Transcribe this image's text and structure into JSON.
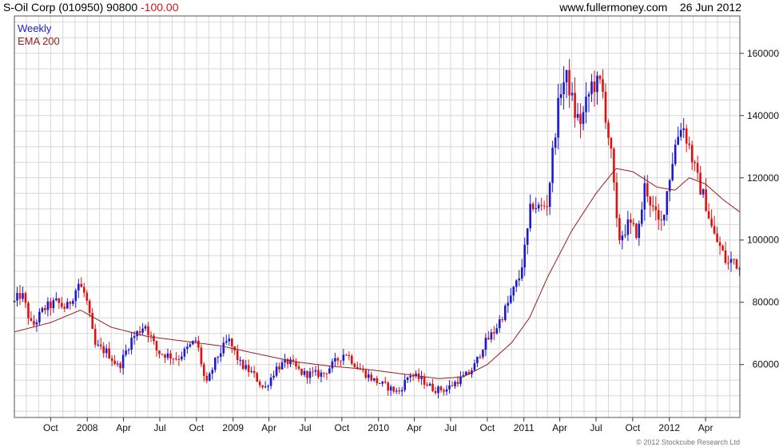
{
  "header": {
    "name": "S-Oil Corp (010950)",
    "price": "90800",
    "change": "-100.00",
    "site": "www.fullermoney.com",
    "date": "26 Jun 2012"
  },
  "colors": {
    "up": "#1a1ad0",
    "down": "#e01010",
    "ema": "#9b1b1b",
    "grid": "#d7d7d7",
    "frame": "#555555"
  },
  "footer": {
    "copyright": "© 2012 Stockcube Research Ltd"
  },
  "chart_data": {
    "type": "candlestick",
    "title": "S-Oil Corp (010950) 90800 -100.00",
    "frequency": "weekly",
    "legend": [
      {
        "label": "Weekly",
        "color": "#2020c0"
      },
      {
        "label": "EMA 200",
        "color": "#9b1b1b"
      }
    ],
    "legend_position": "top-left",
    "x_ticks": [
      "Oct",
      "2008",
      "Apr",
      "Jul",
      "Oct",
      "2009",
      "Apr",
      "Jul",
      "Oct",
      "2010",
      "Apr",
      "Jul",
      "Oct",
      "2011",
      "Apr",
      "Jul",
      "Oct",
      "2012",
      "Apr"
    ],
    "x_range": [
      "2007-07-02",
      "2012-06-26"
    ],
    "y_ticks": [
      60000,
      80000,
      100000,
      120000,
      140000,
      160000
    ],
    "ylim": [
      43000,
      172000
    ],
    "y_axis_side": "right",
    "grid": true,
    "price_path": [
      [
        "2007-07-02",
        80000
      ],
      [
        "2007-07-20",
        83000
      ],
      [
        "2007-08-15",
        72000
      ],
      [
        "2007-09-15",
        78000
      ],
      [
        "2007-10-15",
        80000
      ],
      [
        "2007-11-10",
        78000
      ],
      [
        "2007-12-10",
        86000
      ],
      [
        "2007-12-28",
        82000
      ],
      [
        "2008-01-20",
        66000
      ],
      [
        "2008-02-20",
        64000
      ],
      [
        "2008-03-20",
        59000
      ],
      [
        "2008-04-20",
        68000
      ],
      [
        "2008-05-25",
        73000
      ],
      [
        "2008-06-25",
        64000
      ],
      [
        "2008-08-15",
        62000
      ],
      [
        "2008-10-01",
        68000
      ],
      [
        "2008-10-25",
        53000
      ],
      [
        "2008-11-20",
        62000
      ],
      [
        "2008-12-20",
        68000
      ],
      [
        "2009-01-20",
        60000
      ],
      [
        "2009-02-20",
        57000
      ],
      [
        "2009-03-20",
        52000
      ],
      [
        "2009-04-20",
        59000
      ],
      [
        "2009-05-20",
        61000
      ],
      [
        "2009-06-25",
        57000
      ],
      [
        "2009-08-15",
        57000
      ],
      [
        "2009-10-10",
        64000
      ],
      [
        "2009-11-10",
        59000
      ],
      [
        "2009-12-20",
        55000
      ],
      [
        "2010-01-20",
        53000
      ],
      [
        "2010-02-20",
        51000
      ],
      [
        "2010-03-20",
        57000
      ],
      [
        "2010-04-20",
        55000
      ],
      [
        "2010-05-20",
        52000
      ],
      [
        "2010-06-20",
        52000
      ],
      [
        "2010-07-20",
        55000
      ],
      [
        "2010-08-15",
        57000
      ],
      [
        "2010-09-01",
        60000
      ],
      [
        "2010-09-20",
        66000
      ],
      [
        "2010-10-20",
        71000
      ],
      [
        "2010-11-20",
        79000
      ],
      [
        "2010-12-20",
        88000
      ],
      [
        "2011-01-05",
        98000
      ],
      [
        "2011-01-20",
        112000
      ],
      [
        "2011-02-10",
        110000
      ],
      [
        "2011-03-01",
        112000
      ],
      [
        "2011-03-20",
        135000
      ],
      [
        "2011-04-05",
        150000
      ],
      [
        "2011-04-20",
        152000
      ],
      [
        "2011-05-10",
        140000
      ],
      [
        "2011-05-25",
        138000
      ],
      [
        "2011-06-20",
        150000
      ],
      [
        "2011-07-15",
        150000
      ],
      [
        "2011-08-10",
        125000
      ],
      [
        "2011-08-25",
        100000
      ],
      [
        "2011-09-20",
        105000
      ],
      [
        "2011-10-15",
        102000
      ],
      [
        "2011-11-01",
        118000
      ],
      [
        "2011-11-20",
        110000
      ],
      [
        "2011-12-10",
        104000
      ],
      [
        "2011-12-25",
        115000
      ],
      [
        "2012-01-15",
        130000
      ],
      [
        "2012-02-01",
        138000
      ],
      [
        "2012-02-20",
        130000
      ],
      [
        "2012-03-10",
        120000
      ],
      [
        "2012-04-01",
        112000
      ],
      [
        "2012-04-20",
        102000
      ],
      [
        "2012-05-10",
        97000
      ],
      [
        "2012-05-25",
        92000
      ],
      [
        "2012-06-10",
        94000
      ],
      [
        "2012-06-26",
        90800
      ]
    ],
    "ema200_path": [
      [
        "2007-07-02",
        70500
      ],
      [
        "2007-10-01",
        73500
      ],
      [
        "2007-12-15",
        77500
      ],
      [
        "2008-03-01",
        72000
      ],
      [
        "2008-06-01",
        69000
      ],
      [
        "2008-09-01",
        67500
      ],
      [
        "2008-12-01",
        66000
      ],
      [
        "2009-03-01",
        63500
      ],
      [
        "2009-06-01",
        61000
      ],
      [
        "2009-09-01",
        59500
      ],
      [
        "2009-12-01",
        58500
      ],
      [
        "2010-03-01",
        57000
      ],
      [
        "2010-06-01",
        55500
      ],
      [
        "2010-08-01",
        56000
      ],
      [
        "2010-10-01",
        60000
      ],
      [
        "2010-12-01",
        67000
      ],
      [
        "2011-01-15",
        75000
      ],
      [
        "2011-03-01",
        88000
      ],
      [
        "2011-05-01",
        103000
      ],
      [
        "2011-07-01",
        115000
      ],
      [
        "2011-08-20",
        123000
      ],
      [
        "2011-10-01",
        122000
      ],
      [
        "2011-12-01",
        117000
      ],
      [
        "2012-01-15",
        116000
      ],
      [
        "2012-02-20",
        120000
      ],
      [
        "2012-04-01",
        118000
      ],
      [
        "2012-05-15",
        113000
      ],
      [
        "2012-06-26",
        109000
      ]
    ]
  }
}
